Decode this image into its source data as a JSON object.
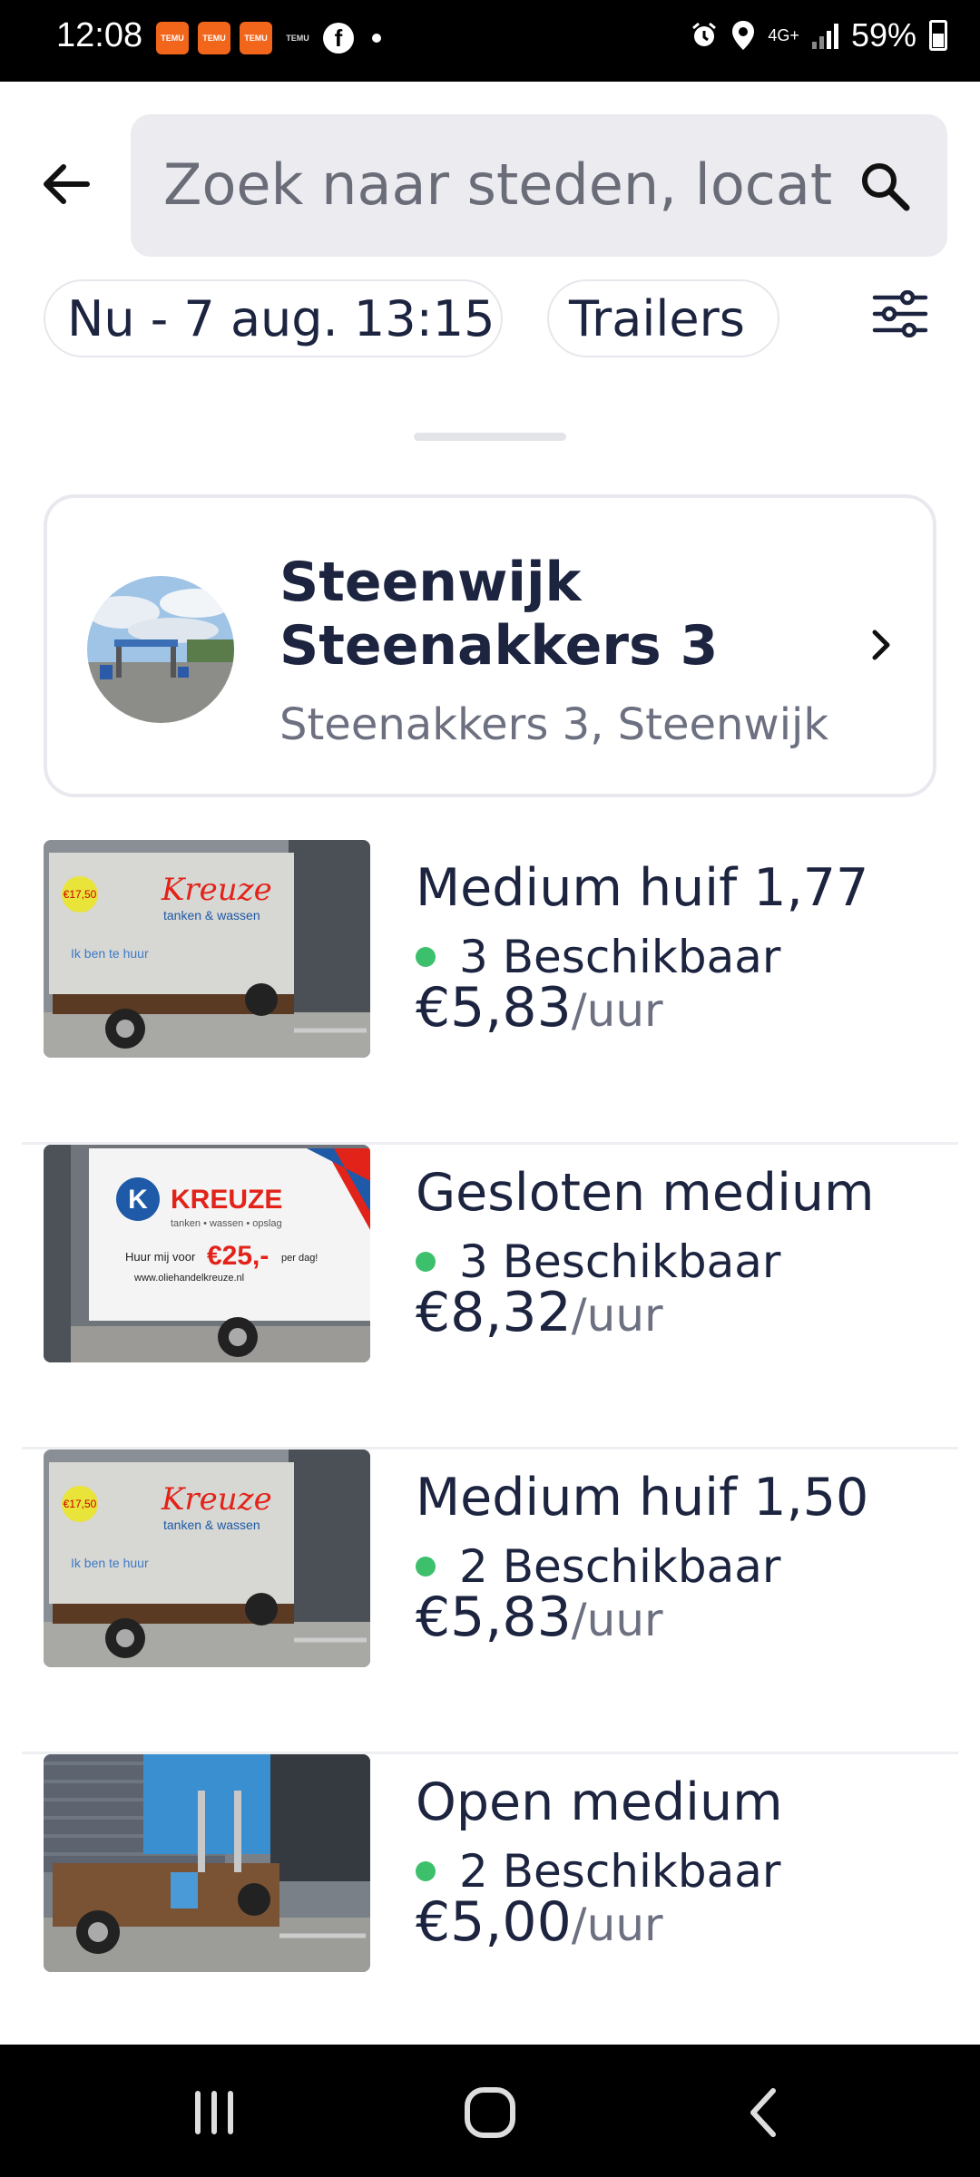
{
  "status_bar": {
    "time": "12:08",
    "battery": "59%",
    "network": "4G+",
    "notification_apps": [
      "TEMU",
      "TEMU",
      "TEMU",
      "TEMU",
      "Facebook"
    ],
    "icons": [
      "alarm-icon",
      "location-icon",
      "signal-icon",
      "battery-icon"
    ]
  },
  "search": {
    "placeholder": "Zoek naar steden, locatie",
    "value": ""
  },
  "filters": {
    "date_range": "Nu - 7 aug. 13:15",
    "vehicle_type": "Trailers"
  },
  "location": {
    "name": "Steenwijk Steenakkers 3",
    "address": "Steenakkers 3, Steenwijk"
  },
  "listings": [
    {
      "title": "Medium huif 1,77",
      "availability": "3 Beschikbaar",
      "price": "€5,83",
      "unit": "/uur",
      "image": "kreuze-canopy-trailer"
    },
    {
      "title": "Gesloten medium",
      "availability": "3 Beschikbaar",
      "price": "€8,32",
      "unit": "/uur",
      "image": "kreuze-closed-trailer"
    },
    {
      "title": "Medium huif 1,50",
      "availability": "2 Beschikbaar",
      "price": "€5,83",
      "unit": "/uur",
      "image": "kreuze-canopy-trailer"
    },
    {
      "title": "Open medium",
      "availability": "2 Beschikbaar",
      "price": "€5,00",
      "unit": "/uur",
      "image": "open-trailer"
    }
  ],
  "colors": {
    "text": "#1c2440",
    "muted": "#6d7080",
    "available": "#3cc06c",
    "search_bg": "#ebebf0",
    "brand_red": "#e2231a",
    "brand_blue": "#1e5aa8"
  }
}
